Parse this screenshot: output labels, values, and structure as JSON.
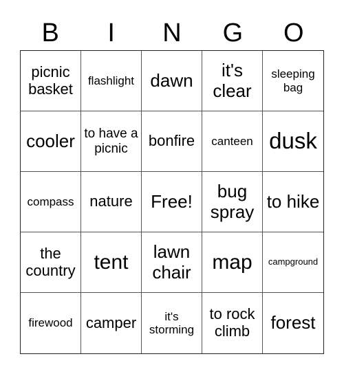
{
  "card": {
    "header": [
      "B",
      "I",
      "N",
      "G",
      "O"
    ],
    "cells": [
      {
        "text": "picnic basket",
        "size": "md"
      },
      {
        "text": "flashlight",
        "size": "sm"
      },
      {
        "text": "dawn",
        "size": "lg"
      },
      {
        "text": "it's clear",
        "size": "lg"
      },
      {
        "text": "sleeping bag",
        "size": "sm"
      },
      {
        "text": "cooler",
        "size": "lg"
      },
      {
        "text": "to have a picnic",
        "size": "smd"
      },
      {
        "text": "bonfire",
        "size": "md"
      },
      {
        "text": "canteen",
        "size": "sm"
      },
      {
        "text": "dusk",
        "size": "xxl"
      },
      {
        "text": "compass",
        "size": "sm"
      },
      {
        "text": "nature",
        "size": "md"
      },
      {
        "text": "Free!",
        "size": "lg"
      },
      {
        "text": "bug spray",
        "size": "lg"
      },
      {
        "text": "to hike",
        "size": "lg"
      },
      {
        "text": "the country",
        "size": "md"
      },
      {
        "text": "tent",
        "size": "xl"
      },
      {
        "text": "lawn chair",
        "size": "lg"
      },
      {
        "text": "map",
        "size": "xl"
      },
      {
        "text": "campground",
        "size": "xs"
      },
      {
        "text": "firewood",
        "size": "sm"
      },
      {
        "text": "camper",
        "size": "md"
      },
      {
        "text": "it's storming",
        "size": "sm"
      },
      {
        "text": "to rock climb",
        "size": "md"
      },
      {
        "text": "forest",
        "size": "lg"
      }
    ]
  }
}
